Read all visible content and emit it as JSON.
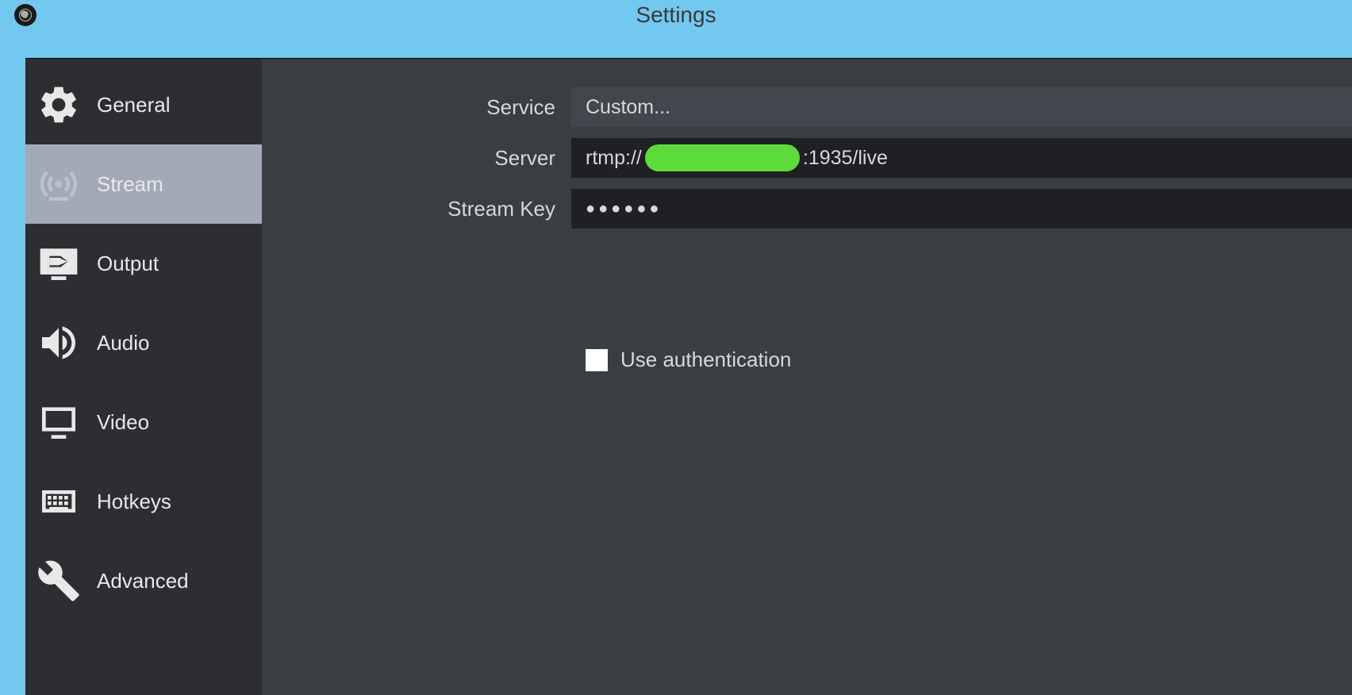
{
  "titlebar": {
    "title": "Settings"
  },
  "sidebar": {
    "items": [
      {
        "label": "General"
      },
      {
        "label": "Stream"
      },
      {
        "label": "Output"
      },
      {
        "label": "Audio"
      },
      {
        "label": "Video"
      },
      {
        "label": "Hotkeys"
      },
      {
        "label": "Advanced"
      }
    ],
    "selected_index": 1
  },
  "form": {
    "service": {
      "label": "Service",
      "value": "Custom..."
    },
    "server": {
      "label": "Server",
      "prefix": "rtmp://",
      "suffix": ":1935/live"
    },
    "stream_key": {
      "label": "Stream Key",
      "masked": "●●●●●●"
    },
    "use_auth": {
      "label": "Use authentication",
      "checked": false
    }
  }
}
